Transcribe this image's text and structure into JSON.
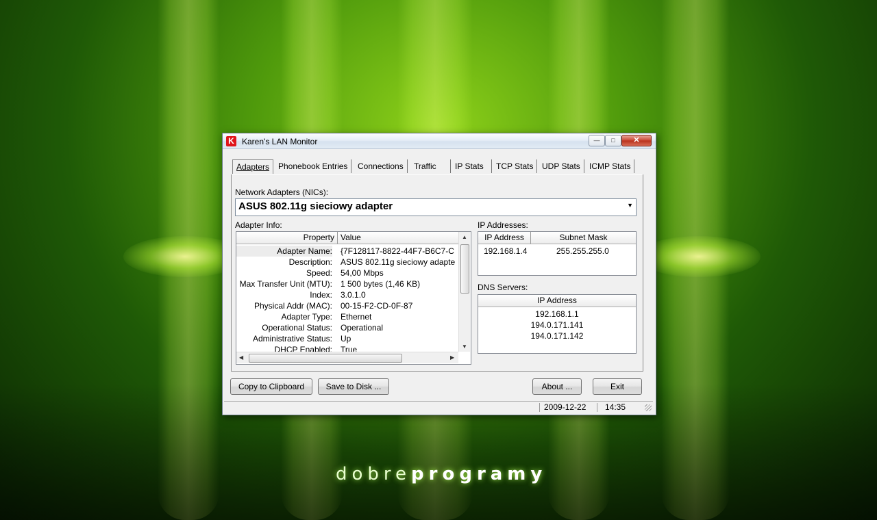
{
  "window": {
    "title": "Karen's LAN Monitor",
    "icon_letter": "K",
    "controls": {
      "minimize": "—",
      "maximize": "□",
      "close": "✕"
    }
  },
  "tabs": [
    {
      "label": "Adapters",
      "active": true
    },
    {
      "label": "Phonebook Entries"
    },
    {
      "label": "Connections"
    },
    {
      "label": "Traffic"
    },
    {
      "label": "IP Stats"
    },
    {
      "label": "TCP Stats"
    },
    {
      "label": "UDP Stats"
    },
    {
      "label": "ICMP Stats"
    }
  ],
  "adapters": {
    "nics_label": "Network Adapters (NICs):",
    "selected_adapter": "ASUS 802.11g sieciowy adapter",
    "adapter_info_label": "Adapter Info:",
    "columns": [
      "Property",
      "Value"
    ],
    "rows": [
      {
        "property": "Adapter Name:",
        "value": "{7F128117-8822-44F7-B6C7-C"
      },
      {
        "property": "Description:",
        "value": "ASUS 802.11g sieciowy adapte"
      },
      {
        "property": "Speed:",
        "value": "54,00 Mbps"
      },
      {
        "property": "Max Transfer Unit (MTU):",
        "value": "1 500 bytes (1,46 KB)"
      },
      {
        "property": "Index:",
        "value": "3.0.1.0"
      },
      {
        "property": "Physical Addr (MAC):",
        "value": "00-15-F2-CD-0F-87"
      },
      {
        "property": "Adapter Type:",
        "value": "Ethernet"
      },
      {
        "property": "Operational Status:",
        "value": "Operational"
      },
      {
        "property": "Administrative Status:",
        "value": "Up"
      },
      {
        "property": "DHCP Enabled:",
        "value": "True"
      }
    ],
    "ip_label": "IP Addresses:",
    "ip_columns": [
      "IP Address",
      "Subnet Mask"
    ],
    "ip_rows": [
      {
        "ip": "192.168.1.4",
        "mask": "255.255.255.0"
      }
    ],
    "dns_label": "DNS Servers:",
    "dns_column": "IP Address",
    "dns_rows": [
      "192.168.1.1",
      "194.0.171.141",
      "194.0.171.142"
    ]
  },
  "buttons": {
    "copy": "Copy to Clipboard",
    "save": "Save to Disk ...",
    "about": "About ...",
    "exit": "Exit"
  },
  "statusbar": {
    "date": "2009-12-22",
    "time": "14:35"
  },
  "wallpaper": {
    "brand_light": "dobre",
    "brand_bold": "programy"
  },
  "colors": {
    "accent_green": "#8fd21a",
    "close_red": "#c9442f",
    "icon_red": "#e0151b"
  }
}
